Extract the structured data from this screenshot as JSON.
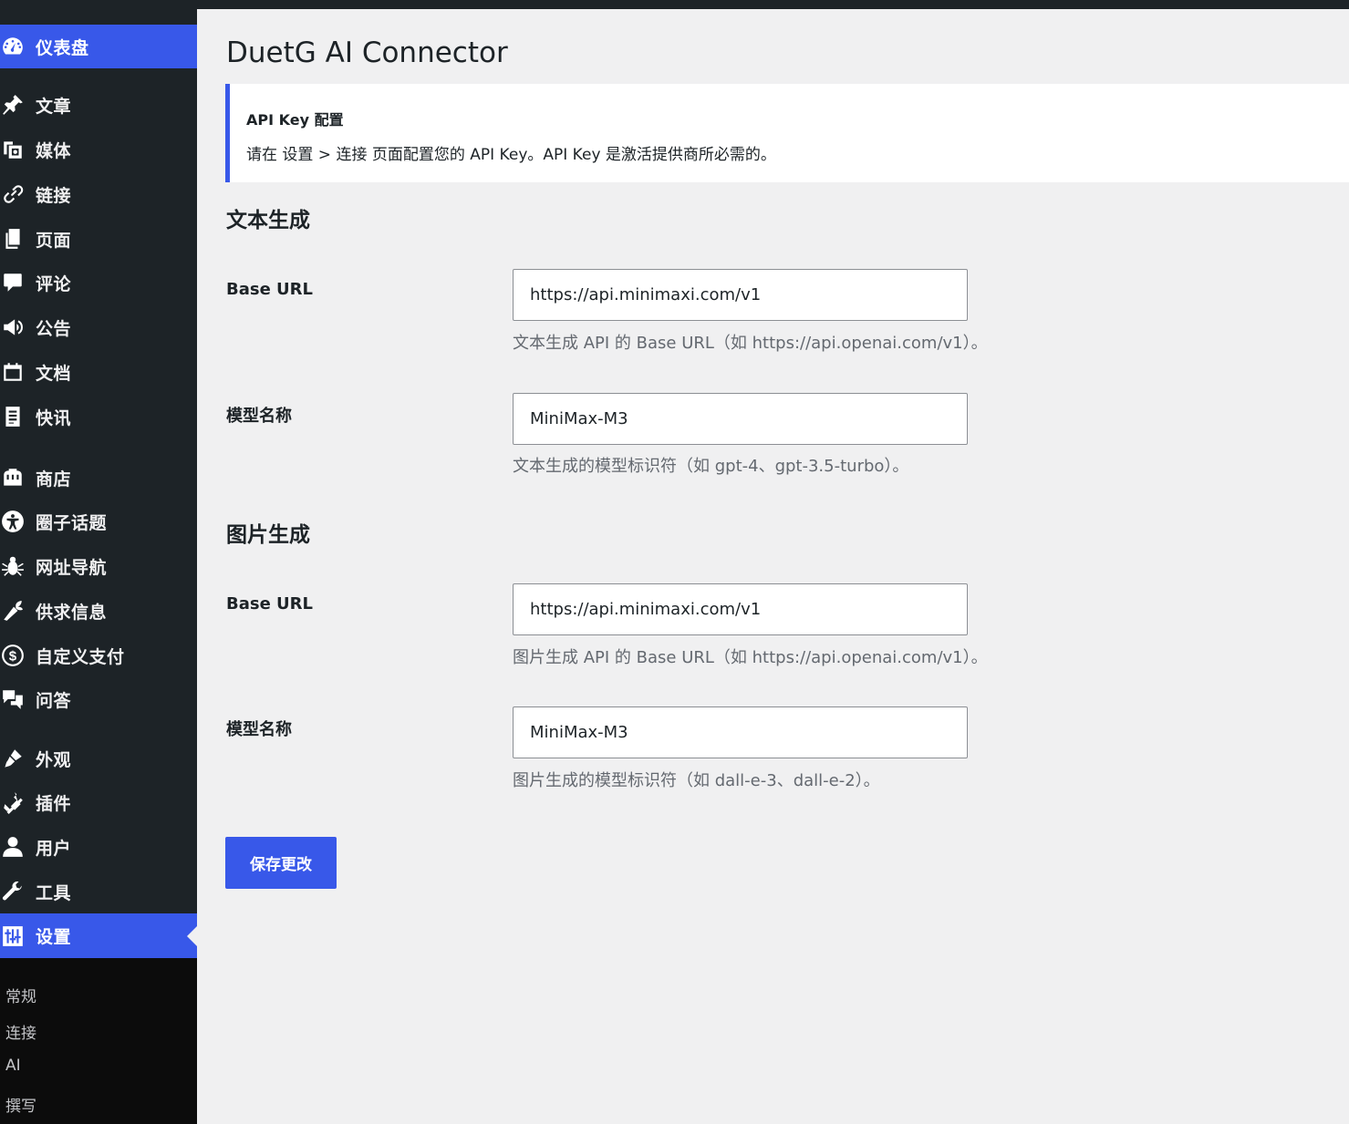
{
  "colors": {
    "accent": "#3858e9",
    "sidebar_bg": "#1d2327",
    "submenu_bg": "#0c0c0c",
    "page_bg": "#f0f0f1"
  },
  "sidebar": {
    "items": [
      {
        "label": "仪表盘",
        "icon": "dashboard-icon",
        "active": true
      },
      {
        "label": "文章",
        "icon": "pin-icon"
      },
      {
        "label": "媒体",
        "icon": "media-icon"
      },
      {
        "label": "链接",
        "icon": "link-icon"
      },
      {
        "label": "页面",
        "icon": "pages-icon"
      },
      {
        "label": "评论",
        "icon": "comment-icon"
      },
      {
        "label": "公告",
        "icon": "megaphone-icon"
      },
      {
        "label": "文档",
        "icon": "docs-icon"
      },
      {
        "label": "快讯",
        "icon": "news-icon"
      },
      {
        "label": "商店",
        "icon": "store-icon"
      },
      {
        "label": "圈子话题",
        "icon": "universal-access-icon"
      },
      {
        "label": "网址导航",
        "icon": "bug-icon"
      },
      {
        "label": "供求信息",
        "icon": "carrot-icon"
      },
      {
        "label": "自定义支付",
        "icon": "dollar-icon"
      },
      {
        "label": "问答",
        "icon": "chat-bubbles-icon"
      },
      {
        "label": "外观",
        "icon": "brush-icon"
      },
      {
        "label": "插件",
        "icon": "plug-icon"
      },
      {
        "label": "用户",
        "icon": "user-icon"
      },
      {
        "label": "工具",
        "icon": "wrench-icon"
      },
      {
        "label": "设置",
        "icon": "settings-sliders-icon",
        "active": true
      }
    ],
    "submenu": [
      "常规",
      "连接",
      "AI",
      "撰写"
    ]
  },
  "page": {
    "title": "DuetG AI Connector",
    "notice": {
      "title": "API Key 配置",
      "text": "请在 设置 > 连接 页面配置您的 API Key。API Key 是激活提供商所必需的。"
    },
    "text_section": {
      "title": "文本生成",
      "base_url_label": "Base URL",
      "base_url_value": "https://api.minimaxi.com/v1",
      "base_url_desc": "文本生成 API 的 Base URL（如 https://api.openai.com/v1）。",
      "model_label": "模型名称",
      "model_value": "MiniMax-M3",
      "model_desc": "文本生成的模型标识符（如 gpt-4、gpt-3.5-turbo）。"
    },
    "image_section": {
      "title": "图片生成",
      "base_url_label": "Base URL",
      "base_url_value": "https://api.minimaxi.com/v1",
      "base_url_desc": "图片生成 API 的 Base URL（如 https://api.openai.com/v1）。",
      "model_label": "模型名称",
      "model_value": "MiniMax-M3",
      "model_desc": "图片生成的模型标识符（如 dall-e-3、dall-e-2）。"
    },
    "save_label": "保存更改"
  }
}
